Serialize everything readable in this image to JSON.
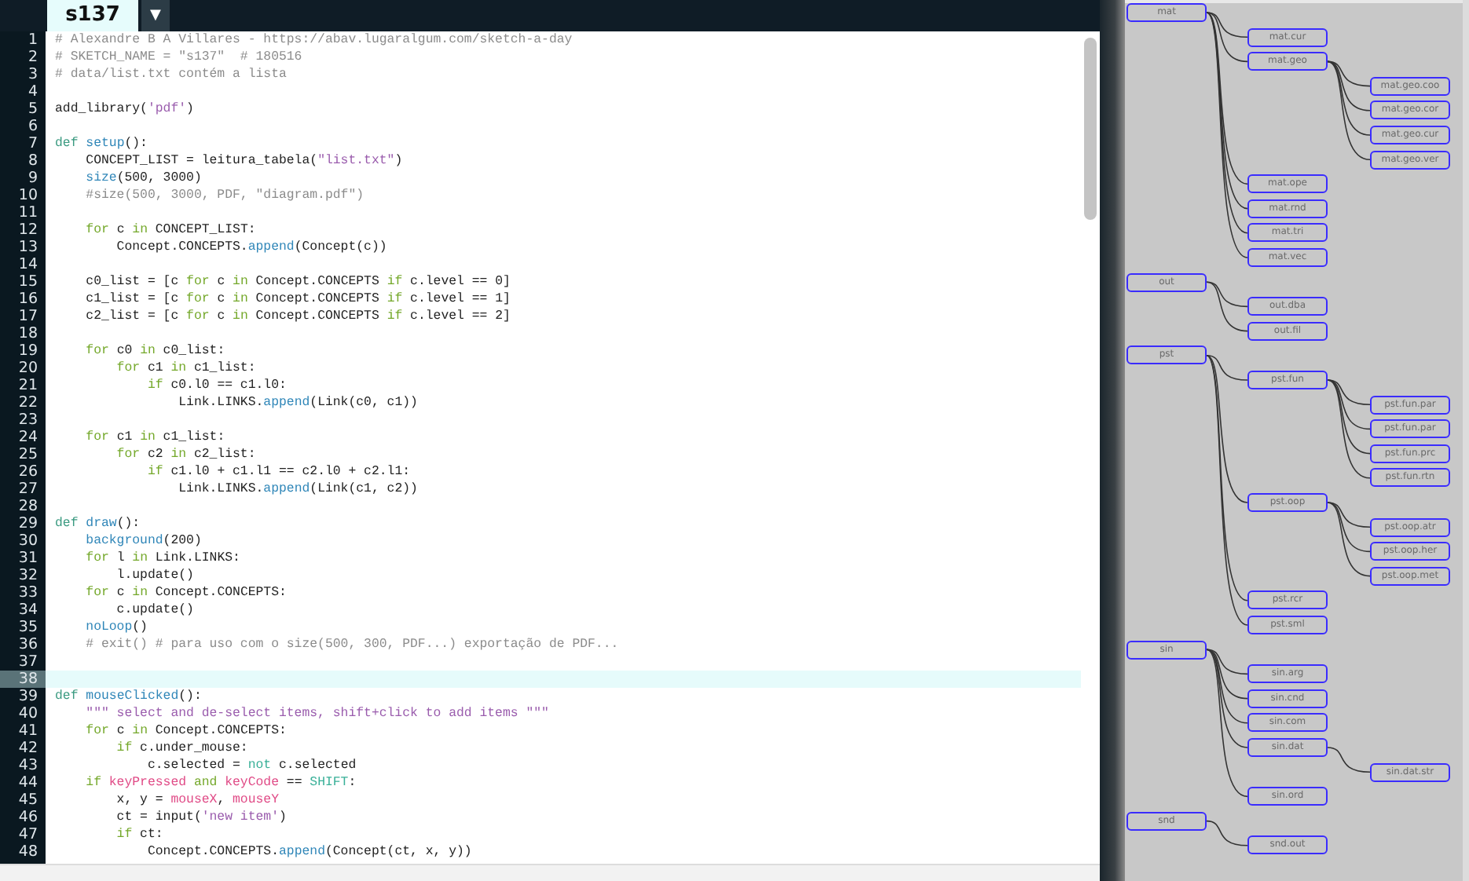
{
  "editor": {
    "tab": {
      "label": "s137",
      "selected": true
    },
    "tab_menu_glyph": "▼",
    "lines": [
      {
        "number": "1",
        "current": false,
        "tokens": [
          {
            "kind": "comment",
            "text": "# Alexandre B A Villares - https://abav.lugaralgum.com/sketch-a-day"
          }
        ]
      },
      {
        "number": "2",
        "current": false,
        "tokens": [
          {
            "kind": "comment",
            "text": "# SKETCH_NAME = \"s137\"  # 180516"
          }
        ]
      },
      {
        "number": "3",
        "current": false,
        "tokens": [
          {
            "kind": "comment",
            "text": "# data/list.txt contém a lista"
          }
        ]
      },
      {
        "number": "4",
        "current": false
      },
      {
        "number": "5",
        "current": false,
        "tokens": [
          {
            "kind": "plain",
            "text": "add_library("
          },
          {
            "kind": "string",
            "text": "'pdf'"
          },
          {
            "kind": "plain",
            "text": ")"
          }
        ]
      },
      {
        "number": "6",
        "current": false
      },
      {
        "number": "7",
        "current": false,
        "tokens": [
          {
            "kind": "def",
            "text": "def"
          },
          {
            "kind": "func",
            "text": " setup"
          },
          {
            "kind": "plain",
            "text": "():"
          }
        ]
      },
      {
        "number": "8",
        "current": false,
        "tokens": [
          {
            "kind": "plain",
            "text": "    CONCEPT_LIST = leitura_tabela("
          },
          {
            "kind": "string",
            "text": "\"list.txt\""
          },
          {
            "kind": "plain",
            "text": ")"
          }
        ]
      },
      {
        "number": "9",
        "current": false,
        "tokens": [
          {
            "kind": "func",
            "text": "    size"
          },
          {
            "kind": "plain",
            "text": "(500, 3000)"
          }
        ]
      },
      {
        "number": "10",
        "current": false,
        "tokens": [
          {
            "kind": "comment",
            "text": "    #size(500, 3000, PDF, \"diagram.pdf\")"
          }
        ]
      },
      {
        "number": "11",
        "current": false
      },
      {
        "number": "12",
        "current": false,
        "tokens": [
          {
            "kind": "keyword",
            "text": "    for"
          },
          {
            "kind": "plain",
            "text": " c "
          },
          {
            "kind": "keyword",
            "text": "in"
          },
          {
            "kind": "plain",
            "text": " CONCEPT_LIST:"
          }
        ]
      },
      {
        "number": "13",
        "current": false,
        "tokens": [
          {
            "kind": "plain",
            "text": "        Concept.CONCEPTS."
          },
          {
            "kind": "func",
            "text": "append"
          },
          {
            "kind": "plain",
            "text": "(Concept(c))"
          }
        ]
      },
      {
        "number": "14",
        "current": false
      },
      {
        "number": "15",
        "current": false,
        "tokens": [
          {
            "kind": "plain",
            "text": "    c0_list = [c "
          },
          {
            "kind": "keyword",
            "text": "for"
          },
          {
            "kind": "plain",
            "text": " c "
          },
          {
            "kind": "keyword",
            "text": "in"
          },
          {
            "kind": "plain",
            "text": " Concept.CONCEPTS "
          },
          {
            "kind": "keyword",
            "text": "if"
          },
          {
            "kind": "plain",
            "text": " c.level == 0]"
          }
        ]
      },
      {
        "number": "16",
        "current": false,
        "tokens": [
          {
            "kind": "plain",
            "text": "    c1_list = [c "
          },
          {
            "kind": "keyword",
            "text": "for"
          },
          {
            "kind": "plain",
            "text": " c "
          },
          {
            "kind": "keyword",
            "text": "in"
          },
          {
            "kind": "plain",
            "text": " Concept.CONCEPTS "
          },
          {
            "kind": "keyword",
            "text": "if"
          },
          {
            "kind": "plain",
            "text": " c.level == 1]"
          }
        ]
      },
      {
        "number": "17",
        "current": false,
        "tokens": [
          {
            "kind": "plain",
            "text": "    c2_list = [c "
          },
          {
            "kind": "keyword",
            "text": "for"
          },
          {
            "kind": "plain",
            "text": " c "
          },
          {
            "kind": "keyword",
            "text": "in"
          },
          {
            "kind": "plain",
            "text": " Concept.CONCEPTS "
          },
          {
            "kind": "keyword",
            "text": "if"
          },
          {
            "kind": "plain",
            "text": " c.level == 2]"
          }
        ]
      },
      {
        "number": "18",
        "current": false
      },
      {
        "number": "19",
        "current": false,
        "tokens": [
          {
            "kind": "keyword",
            "text": "    for"
          },
          {
            "kind": "plain",
            "text": " c0 "
          },
          {
            "kind": "keyword",
            "text": "in"
          },
          {
            "kind": "plain",
            "text": " c0_list:"
          }
        ]
      },
      {
        "number": "20",
        "current": false,
        "tokens": [
          {
            "kind": "keyword",
            "text": "        for"
          },
          {
            "kind": "plain",
            "text": " c1 "
          },
          {
            "kind": "keyword",
            "text": "in"
          },
          {
            "kind": "plain",
            "text": " c1_list:"
          }
        ]
      },
      {
        "number": "21",
        "current": false,
        "tokens": [
          {
            "kind": "keyword",
            "text": "            if"
          },
          {
            "kind": "plain",
            "text": " c0.l0 == c1.l0:"
          }
        ]
      },
      {
        "number": "22",
        "current": false,
        "tokens": [
          {
            "kind": "plain",
            "text": "                Link.LINKS."
          },
          {
            "kind": "func",
            "text": "append"
          },
          {
            "kind": "plain",
            "text": "(Link(c0, c1))"
          }
        ]
      },
      {
        "number": "23",
        "current": false
      },
      {
        "number": "24",
        "current": false,
        "tokens": [
          {
            "kind": "keyword",
            "text": "    for"
          },
          {
            "kind": "plain",
            "text": " c1 "
          },
          {
            "kind": "keyword",
            "text": "in"
          },
          {
            "kind": "plain",
            "text": " c1_list:"
          }
        ]
      },
      {
        "number": "25",
        "current": false,
        "tokens": [
          {
            "kind": "keyword",
            "text": "        for"
          },
          {
            "kind": "plain",
            "text": " c2 "
          },
          {
            "kind": "keyword",
            "text": "in"
          },
          {
            "kind": "plain",
            "text": " c2_list:"
          }
        ]
      },
      {
        "number": "26",
        "current": false,
        "tokens": [
          {
            "kind": "keyword",
            "text": "            if"
          },
          {
            "kind": "plain",
            "text": " c1.l0 + c1.l1 == c2.l0 + c2.l1:"
          }
        ]
      },
      {
        "number": "27",
        "current": false,
        "tokens": [
          {
            "kind": "plain",
            "text": "                Link.LINKS."
          },
          {
            "kind": "func",
            "text": "append"
          },
          {
            "kind": "plain",
            "text": "(Link(c1, c2))"
          }
        ]
      },
      {
        "number": "28",
        "current": false
      },
      {
        "number": "29",
        "current": false,
        "tokens": [
          {
            "kind": "def",
            "text": "def"
          },
          {
            "kind": "func",
            "text": " draw"
          },
          {
            "kind": "plain",
            "text": "():"
          }
        ]
      },
      {
        "number": "30",
        "current": false,
        "tokens": [
          {
            "kind": "func",
            "text": "    background"
          },
          {
            "kind": "plain",
            "text": "(200)"
          }
        ]
      },
      {
        "number": "31",
        "current": false,
        "tokens": [
          {
            "kind": "keyword",
            "text": "    for"
          },
          {
            "kind": "plain",
            "text": " l "
          },
          {
            "kind": "keyword",
            "text": "in"
          },
          {
            "kind": "plain",
            "text": " Link.LINKS:"
          }
        ]
      },
      {
        "number": "32",
        "current": false,
        "tokens": [
          {
            "kind": "plain",
            "text": "        l.update()"
          }
        ]
      },
      {
        "number": "33",
        "current": false,
        "tokens": [
          {
            "kind": "keyword",
            "text": "    for"
          },
          {
            "kind": "plain",
            "text": " c "
          },
          {
            "kind": "keyword",
            "text": "in"
          },
          {
            "kind": "plain",
            "text": " Concept.CONCEPTS:"
          }
        ]
      },
      {
        "number": "34",
        "current": false,
        "tokens": [
          {
            "kind": "plain",
            "text": "        c.update()"
          }
        ]
      },
      {
        "number": "35",
        "current": false,
        "tokens": [
          {
            "kind": "func",
            "text": "    noLoop"
          },
          {
            "kind": "plain",
            "text": "()"
          }
        ]
      },
      {
        "number": "36",
        "current": false,
        "tokens": [
          {
            "kind": "comment",
            "text": "    # exit() # para uso com o size(500, 300, PDF...) exportação de PDF..."
          }
        ]
      },
      {
        "number": "37",
        "current": false
      },
      {
        "number": "38",
        "current": true
      },
      {
        "number": "39",
        "current": false,
        "tokens": [
          {
            "kind": "def",
            "text": "def"
          },
          {
            "kind": "func",
            "text": " mouseClicked"
          },
          {
            "kind": "plain",
            "text": "():"
          }
        ]
      },
      {
        "number": "40",
        "current": false,
        "tokens": [
          {
            "kind": "string",
            "text": "    \"\"\" select and de-select items, shift+click to add items \"\"\""
          }
        ]
      },
      {
        "number": "41",
        "current": false,
        "tokens": [
          {
            "kind": "keyword",
            "text": "    for"
          },
          {
            "kind": "plain",
            "text": " c "
          },
          {
            "kind": "keyword",
            "text": "in"
          },
          {
            "kind": "plain",
            "text": " Concept.CONCEPTS:"
          }
        ]
      },
      {
        "number": "42",
        "current": false,
        "tokens": [
          {
            "kind": "keyword",
            "text": "        if"
          },
          {
            "kind": "plain",
            "text": " c.under_mouse:"
          }
        ]
      },
      {
        "number": "43",
        "current": false,
        "tokens": [
          {
            "kind": "plain",
            "text": "            c.selected = "
          },
          {
            "kind": "constant",
            "text": "not"
          },
          {
            "kind": "plain",
            "text": " c.selected"
          }
        ]
      },
      {
        "number": "44",
        "current": false,
        "tokens": [
          {
            "kind": "keyword",
            "text": "    if"
          },
          {
            "kind": "variable",
            "text": " keyPressed"
          },
          {
            "kind": "keyword",
            "text": " and"
          },
          {
            "kind": "variable",
            "text": " keyCode"
          },
          {
            "kind": "plain",
            "text": " == "
          },
          {
            "kind": "constant",
            "text": "SHIFT"
          },
          {
            "kind": "plain",
            "text": ":"
          }
        ]
      },
      {
        "number": "45",
        "current": false,
        "tokens": [
          {
            "kind": "plain",
            "text": "        x, y = "
          },
          {
            "kind": "variable",
            "text": "mouseX"
          },
          {
            "kind": "plain",
            "text": ", "
          },
          {
            "kind": "variable",
            "text": "mouseY"
          }
        ]
      },
      {
        "number": "46",
        "current": false,
        "tokens": [
          {
            "kind": "plain",
            "text": "        ct = input("
          },
          {
            "kind": "string",
            "text": "'new item'"
          },
          {
            "kind": "plain",
            "text": ")"
          }
        ]
      },
      {
        "number": "47",
        "current": false,
        "tokens": [
          {
            "kind": "keyword",
            "text": "        if"
          },
          {
            "kind": "plain",
            "text": " ct:"
          }
        ]
      },
      {
        "number": "48",
        "current": false,
        "tokens": [
          {
            "kind": "plain",
            "text": "            Concept.CONCEPTS."
          },
          {
            "kind": "func",
            "text": "append"
          },
          {
            "kind": "plain",
            "text": "(Concept(ct, x, y))"
          }
        ]
      }
    ]
  },
  "sketch": {
    "nodes": [
      {
        "label": "mat",
        "children": [
          {
            "label": "mat.cur"
          },
          {
            "label": "mat.geo",
            "children": [
              {
                "label": "mat.geo.coo"
              },
              {
                "label": "mat.geo.cor"
              },
              {
                "label": "mat.geo.cur"
              },
              {
                "label": "mat.geo.ver"
              }
            ]
          },
          {
            "label": "mat.ope"
          },
          {
            "label": "mat.rnd"
          },
          {
            "label": "mat.tri"
          },
          {
            "label": "mat.vec"
          }
        ]
      },
      {
        "label": "out",
        "children": [
          {
            "label": "out.dba"
          },
          {
            "label": "out.fil"
          }
        ]
      },
      {
        "label": "pst",
        "children": [
          {
            "label": "pst.fun",
            "children": [
              {
                "label": "pst.fun.par"
              },
              {
                "label": "pst.fun.par"
              },
              {
                "label": "pst.fun.prc"
              },
              {
                "label": "pst.fun.rtn"
              }
            ]
          },
          {
            "label": "pst.oop",
            "children": [
              {
                "label": "pst.oop.atr"
              },
              {
                "label": "pst.oop.her"
              },
              {
                "label": "pst.oop.met"
              }
            ]
          },
          {
            "label": "pst.rcr"
          },
          {
            "label": "pst.sml"
          }
        ]
      },
      {
        "label": "sin",
        "children": [
          {
            "label": "sin.arg"
          },
          {
            "label": "sin.cnd"
          },
          {
            "label": "sin.com"
          },
          {
            "label": "sin.dat",
            "children": [
              {
                "label": "sin.dat.str"
              }
            ]
          },
          {
            "label": "sin.ord"
          }
        ]
      },
      {
        "label": "snd",
        "children": [
          {
            "label": "snd.out"
          }
        ]
      }
    ]
  }
}
